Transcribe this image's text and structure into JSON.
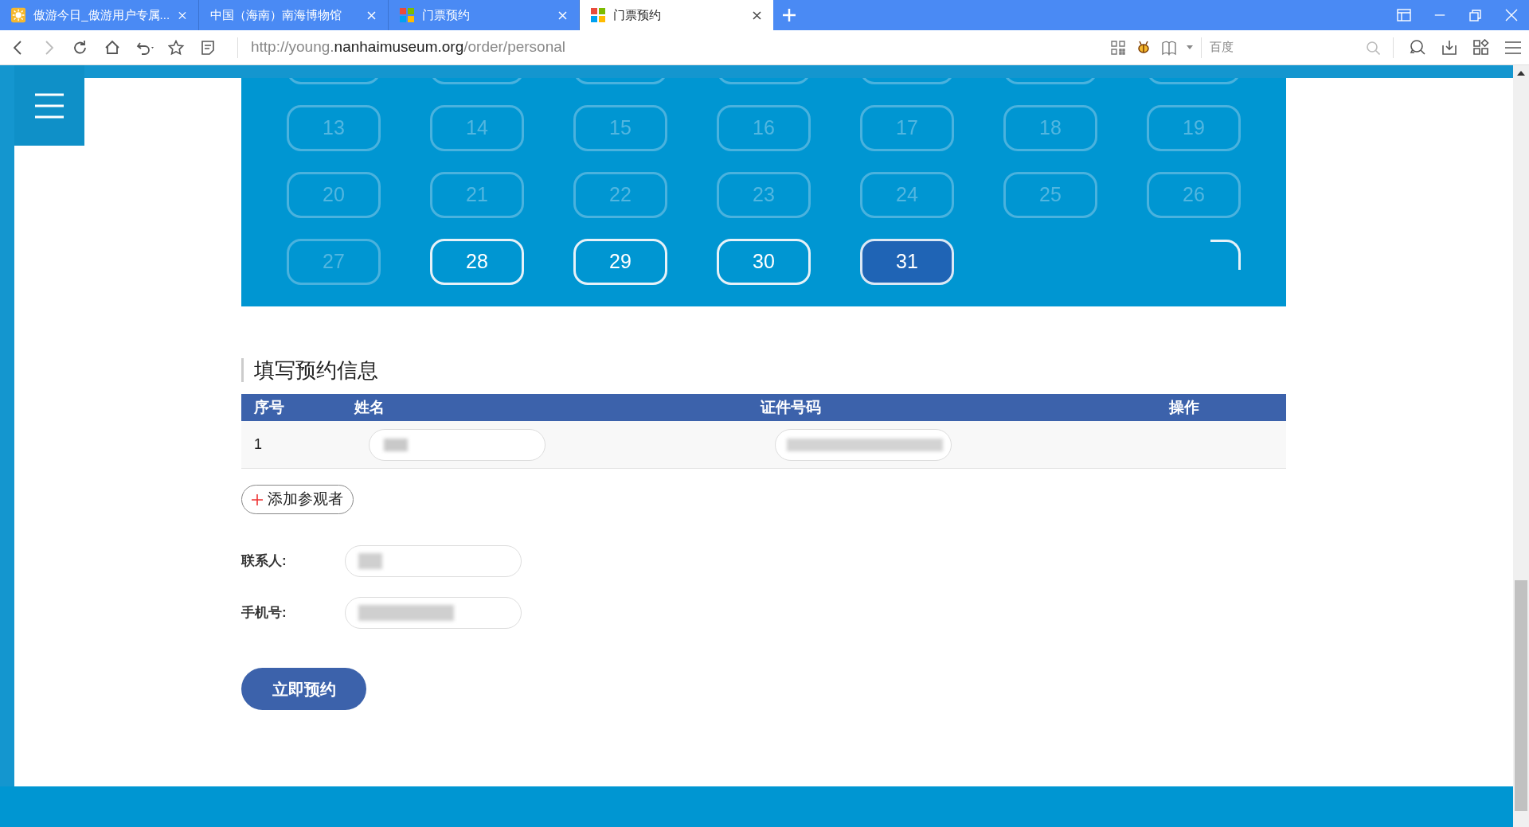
{
  "browser": {
    "tabs": [
      {
        "title": "傲游今日_傲游用户专属...",
        "kind": "sun",
        "selected": false
      },
      {
        "title": "中国（海南）南海博物馆",
        "kind": "plain",
        "selected": false
      },
      {
        "title": "门票预约",
        "kind": "tiles",
        "selected": false
      },
      {
        "title": "门票预约",
        "kind": "tiles",
        "selected": true
      }
    ],
    "address": {
      "prefix": "http://young.",
      "domain": "nanhaimuseum.org",
      "path": "/order/personal"
    },
    "search": {
      "placeholder": "百度"
    }
  },
  "calendar": {
    "days": [
      {
        "label": "13",
        "disabled": true,
        "selected": false
      },
      {
        "label": "14",
        "disabled": true,
        "selected": false
      },
      {
        "label": "15",
        "disabled": true,
        "selected": false
      },
      {
        "label": "16",
        "disabled": true,
        "selected": false
      },
      {
        "label": "17",
        "disabled": true,
        "selected": false
      },
      {
        "label": "18",
        "disabled": true,
        "selected": false
      },
      {
        "label": "19",
        "disabled": true,
        "selected": false
      },
      {
        "label": "20",
        "disabled": true,
        "selected": false
      },
      {
        "label": "21",
        "disabled": true,
        "selected": false
      },
      {
        "label": "22",
        "disabled": true,
        "selected": false
      },
      {
        "label": "23",
        "disabled": true,
        "selected": false
      },
      {
        "label": "24",
        "disabled": true,
        "selected": false
      },
      {
        "label": "25",
        "disabled": true,
        "selected": false
      },
      {
        "label": "26",
        "disabled": true,
        "selected": false
      },
      {
        "label": "27",
        "disabled": true,
        "selected": false
      },
      {
        "label": "28",
        "disabled": false,
        "selected": false
      },
      {
        "label": "29",
        "disabled": false,
        "selected": false
      },
      {
        "label": "30",
        "disabled": false,
        "selected": false
      },
      {
        "label": "31",
        "disabled": false,
        "selected": true
      }
    ]
  },
  "form": {
    "title": "填写预约信息",
    "table": {
      "columns": [
        "序号",
        "姓名",
        "证件号码",
        "操作"
      ],
      "rows": [
        {
          "index": "1"
        }
      ]
    },
    "add_button": "添加参观者",
    "fields": [
      {
        "label": "联系人:"
      },
      {
        "label": "手机号:"
      }
    ],
    "submit": "立即预约"
  }
}
